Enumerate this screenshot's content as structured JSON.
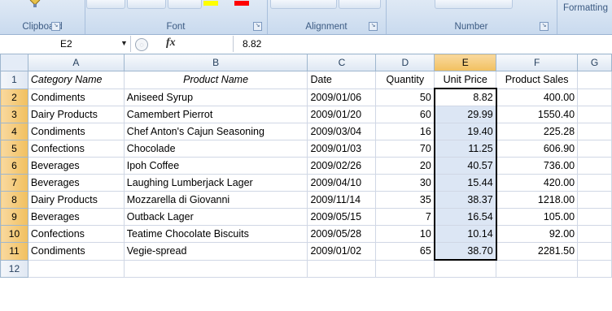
{
  "ribbon": {
    "groups": [
      {
        "label": "Clipboard"
      },
      {
        "label": "Font"
      },
      {
        "label": "Alignment"
      },
      {
        "label": "Number"
      }
    ],
    "styles_label": "Formatting",
    "colors": {
      "highlight": "#ffff00",
      "font_color": "#ff0000"
    }
  },
  "formula_bar": {
    "name_box": "E2",
    "fx_label": "fx",
    "value": "8.82"
  },
  "columns": [
    "A",
    "B",
    "C",
    "D",
    "E",
    "F",
    "G"
  ],
  "selected_column": "E",
  "header_row": {
    "row": "1",
    "cells": [
      "Category Name",
      "Product Name",
      "Date",
      "Quantity",
      "Unit Price",
      "Product Sales",
      ""
    ]
  },
  "rows": [
    {
      "row": "2",
      "cells": [
        "Condiments",
        "Aniseed Syrup",
        "2009/01/06",
        "50",
        "8.82",
        "400.00",
        ""
      ]
    },
    {
      "row": "3",
      "cells": [
        "Dairy Products",
        "Camembert Pierrot",
        "2009/01/20",
        "60",
        "29.99",
        "1550.40",
        ""
      ]
    },
    {
      "row": "4",
      "cells": [
        "Condiments",
        "Chef Anton's Cajun Seasoning",
        "2009/03/04",
        "16",
        "19.40",
        "225.28",
        ""
      ]
    },
    {
      "row": "5",
      "cells": [
        "Confections",
        "Chocolade",
        "2009/01/03",
        "70",
        "11.25",
        "606.90",
        ""
      ]
    },
    {
      "row": "6",
      "cells": [
        "Beverages",
        "Ipoh Coffee",
        "2009/02/26",
        "20",
        "40.57",
        "736.00",
        ""
      ]
    },
    {
      "row": "7",
      "cells": [
        "Beverages",
        "Laughing Lumberjack Lager",
        "2009/04/10",
        "30",
        "15.44",
        "420.00",
        ""
      ]
    },
    {
      "row": "8",
      "cells": [
        "Dairy Products",
        "Mozzarella di Giovanni",
        "2009/11/14",
        "35",
        "38.37",
        "1218.00",
        ""
      ]
    },
    {
      "row": "9",
      "cells": [
        "Beverages",
        "Outback Lager",
        "2009/05/15",
        "7",
        "16.54",
        "105.00",
        ""
      ]
    },
    {
      "row": "10",
      "cells": [
        "Confections",
        "Teatime Chocolate Biscuits",
        "2009/05/28",
        "10",
        "10.14",
        "92.00",
        ""
      ]
    },
    {
      "row": "11",
      "cells": [
        "Condiments",
        "Vegie-spread",
        "2009/01/02",
        "65",
        "38.70",
        "2281.50",
        ""
      ]
    },
    {
      "row": "12",
      "cells": [
        "",
        "",
        "",
        "",
        "",
        "",
        ""
      ]
    }
  ]
}
